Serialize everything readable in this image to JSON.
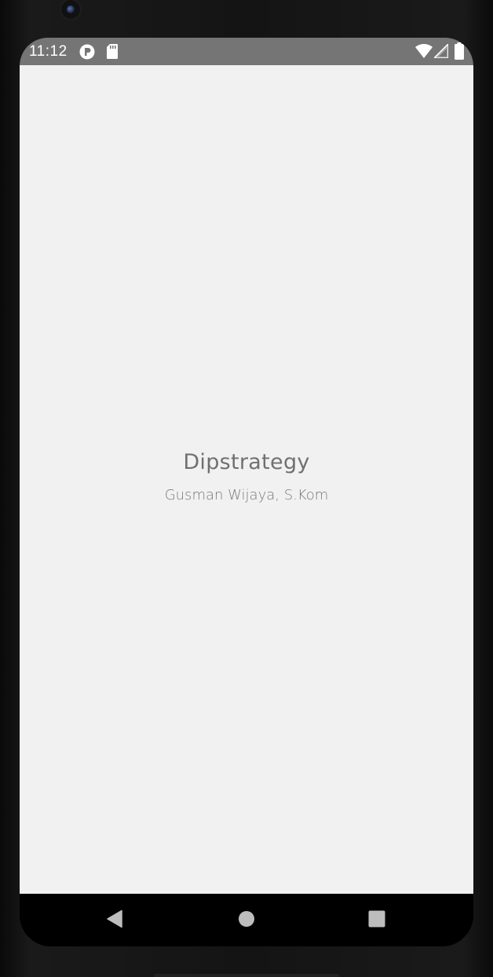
{
  "status_bar": {
    "time": "11:12",
    "left_icons": [
      "app-notification-icon",
      "sd-card-icon"
    ],
    "right_icons": [
      "wifi-icon",
      "cellular-signal-icon",
      "battery-icon"
    ],
    "background_color": "#757575"
  },
  "splash": {
    "title": "Dipstrategy",
    "subtitle": "Gusman Wijaya, S.Kom",
    "background_color": "#f1f1f1",
    "text_color": "#707070"
  },
  "navigation_bar": {
    "buttons": [
      "back-icon",
      "home-icon",
      "recents-icon"
    ]
  }
}
